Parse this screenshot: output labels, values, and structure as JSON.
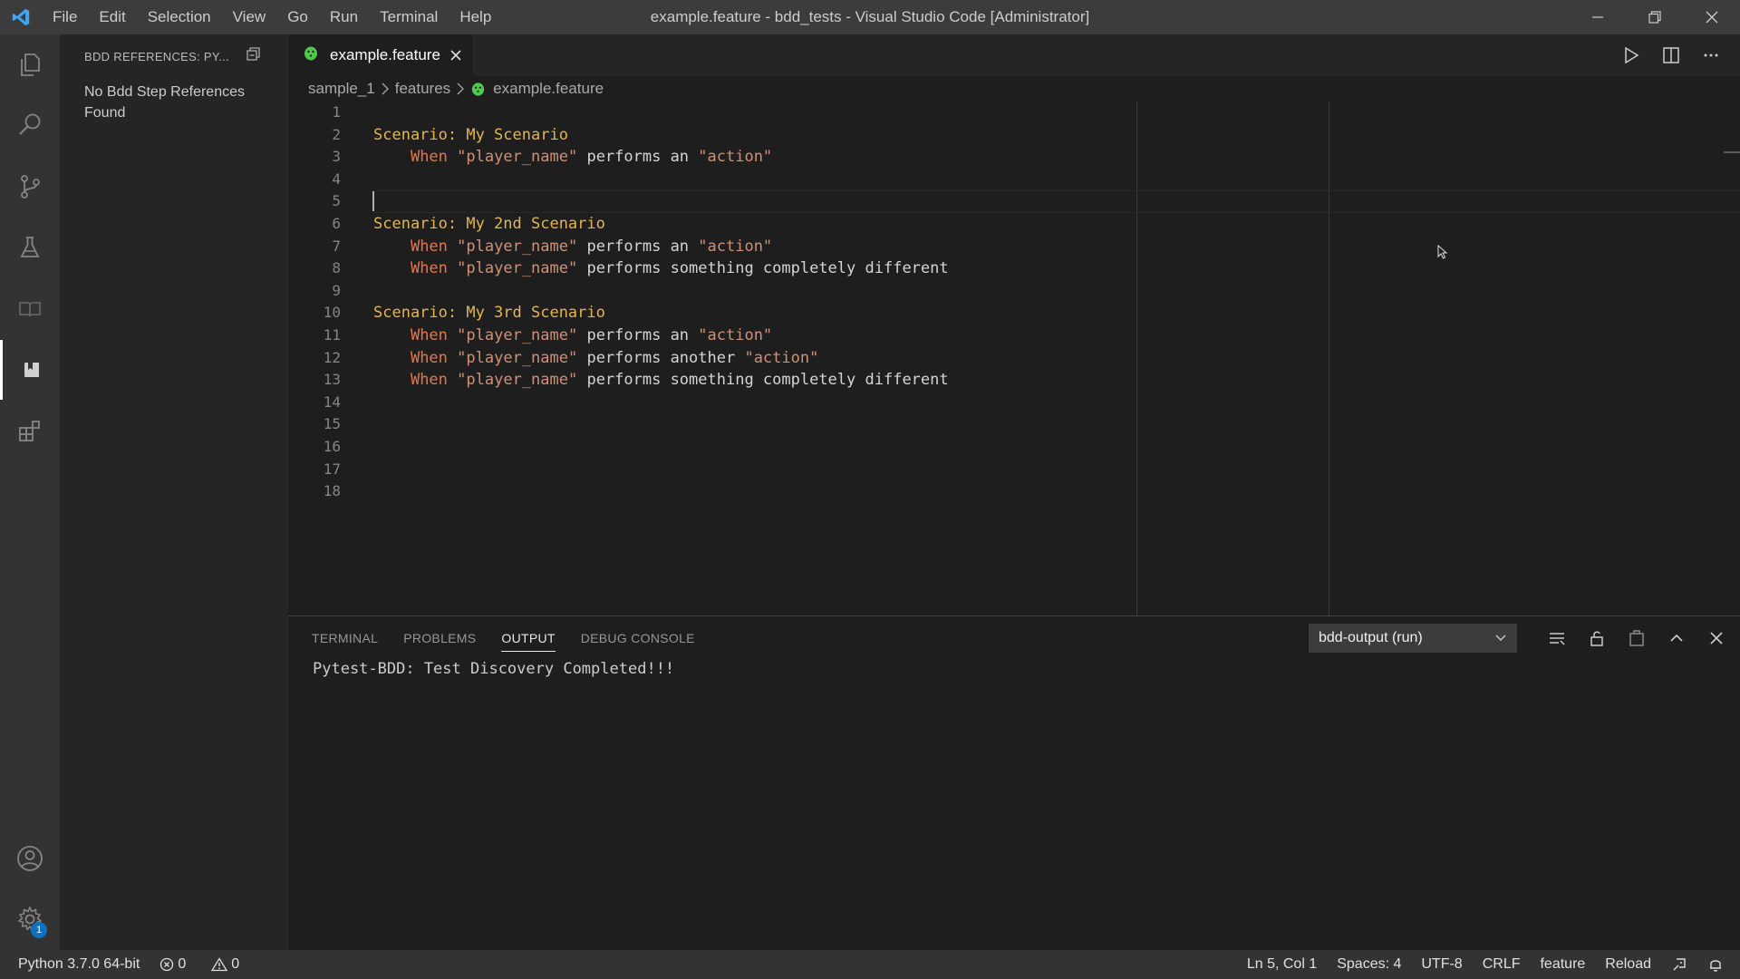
{
  "window": {
    "title": "example.feature - bdd_tests - Visual Studio Code [Administrator]",
    "menu": [
      "File",
      "Edit",
      "Selection",
      "View",
      "Go",
      "Run",
      "Terminal",
      "Help"
    ]
  },
  "sidebar": {
    "header": "BDD REFERENCES: PY...",
    "message": "No Bdd Step References Found"
  },
  "activity_bar": {
    "icons": [
      "explorer-icon",
      "search-icon",
      "source-control-icon",
      "testing-icon",
      "book-icon",
      "bdd-references-icon",
      "extensions-icon",
      "account-icon",
      "settings-gear-icon"
    ],
    "settings_badge": "1"
  },
  "tab": {
    "label": "example.feature"
  },
  "breadcrumb": [
    "sample_1",
    "features",
    "example.feature"
  ],
  "editor": {
    "line_numbers": [
      "1",
      "2",
      "3",
      "4",
      "5",
      "6",
      "7",
      "8",
      "9",
      "10",
      "11",
      "12",
      "13",
      "14",
      "15",
      "16",
      "17",
      "18"
    ],
    "lines": [
      {
        "n": 2,
        "parts": [
          {
            "c": "kw-scenario",
            "t": "Scenario: My Scenario"
          }
        ]
      },
      {
        "n": 3,
        "parts": [
          {
            "c": "plain",
            "t": "    "
          },
          {
            "c": "kw-when",
            "t": "When"
          },
          {
            "c": "plain",
            "t": " "
          },
          {
            "c": "str",
            "t": "\"player_name\""
          },
          {
            "c": "plain",
            "t": " performs an "
          },
          {
            "c": "str",
            "t": "\"action\""
          }
        ]
      },
      {
        "n": 6,
        "parts": [
          {
            "c": "kw-scenario",
            "t": "Scenario: My 2nd Scenario"
          }
        ]
      },
      {
        "n": 7,
        "parts": [
          {
            "c": "plain",
            "t": "    "
          },
          {
            "c": "kw-when",
            "t": "When"
          },
          {
            "c": "plain",
            "t": " "
          },
          {
            "c": "str",
            "t": "\"player_name\""
          },
          {
            "c": "plain",
            "t": " performs an "
          },
          {
            "c": "str",
            "t": "\"action\""
          }
        ]
      },
      {
        "n": 8,
        "parts": [
          {
            "c": "plain",
            "t": "    "
          },
          {
            "c": "kw-when",
            "t": "When"
          },
          {
            "c": "plain",
            "t": " "
          },
          {
            "c": "str",
            "t": "\"player_name\""
          },
          {
            "c": "plain",
            "t": " performs something completely different"
          }
        ]
      },
      {
        "n": 10,
        "parts": [
          {
            "c": "kw-scenario",
            "t": "Scenario: My 3rd Scenario"
          }
        ]
      },
      {
        "n": 11,
        "parts": [
          {
            "c": "plain",
            "t": "    "
          },
          {
            "c": "kw-when",
            "t": "When"
          },
          {
            "c": "plain",
            "t": " "
          },
          {
            "c": "str",
            "t": "\"player_name\""
          },
          {
            "c": "plain",
            "t": " performs an "
          },
          {
            "c": "str",
            "t": "\"action\""
          }
        ]
      },
      {
        "n": 12,
        "parts": [
          {
            "c": "plain",
            "t": "    "
          },
          {
            "c": "kw-when",
            "t": "When"
          },
          {
            "c": "plain",
            "t": " "
          },
          {
            "c": "str",
            "t": "\"player_name\""
          },
          {
            "c": "plain",
            "t": " performs another "
          },
          {
            "c": "str",
            "t": "\"action\""
          }
        ]
      },
      {
        "n": 13,
        "parts": [
          {
            "c": "plain",
            "t": "    "
          },
          {
            "c": "kw-when",
            "t": "When"
          },
          {
            "c": "plain",
            "t": " "
          },
          {
            "c": "str",
            "t": "\"player_name\""
          },
          {
            "c": "plain",
            "t": " performs something completely different"
          }
        ]
      }
    ],
    "cursor_line": 5
  },
  "panel": {
    "tabs": [
      "TERMINAL",
      "PROBLEMS",
      "OUTPUT",
      "DEBUG CONSOLE"
    ],
    "active_tab": "OUTPUT",
    "output_channel": "bdd-output (run)",
    "output_text": "Pytest-BDD: Test Discovery Completed!!!"
  },
  "status_bar": {
    "python": "Python 3.7.0 64-bit",
    "errors": "0",
    "warnings": "0",
    "position": "Ln 5, Col 1",
    "spaces": "Spaces: 4",
    "encoding": "UTF-8",
    "eol": "CRLF",
    "language": "feature",
    "reload": "Reload"
  },
  "colors": {
    "scenario_keyword": "#e2b552",
    "when_keyword": "#e8744a",
    "string": "#ce9178",
    "cucumber_green": "#4ec94e",
    "badge_blue": "#0e70c0"
  }
}
